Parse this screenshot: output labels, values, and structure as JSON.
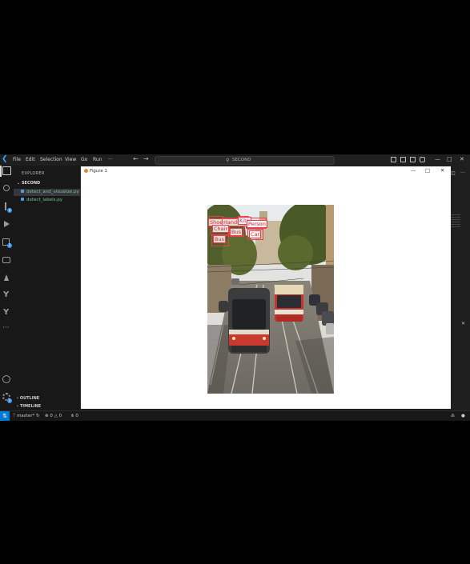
{
  "titlebar": {
    "menu": [
      "File",
      "Edit",
      "Selection",
      "View",
      "Go",
      "Run",
      "···"
    ],
    "command_center": "SECOND"
  },
  "activity_bar": {
    "badges": {
      "source_control": "4",
      "extensions": "2",
      "manage": "1"
    }
  },
  "sidebar": {
    "title": "EXPLORER",
    "folder": "SECOND",
    "files": [
      "detect_and_visualize.py",
      "detect_labels.py"
    ],
    "outline": "OUTLINE",
    "timeline": "TIMELINE"
  },
  "figure_window": {
    "title": "Figure 1",
    "labels": [
      {
        "text": "Shoe"
      },
      {
        "text": "Handbag"
      },
      {
        "text": "Kite"
      },
      {
        "text": "Person"
      },
      {
        "text": "Chair"
      },
      {
        "text": "Bus"
      },
      {
        "text": "Car"
      },
      {
        "text": "Bus"
      }
    ]
  },
  "statusbar": {
    "branch": "master*",
    "errors": "0",
    "warnings": "0",
    "ports": "0"
  },
  "colors": {
    "accent": "#0078d4",
    "detection_box": "#e8404f",
    "file_modified": "#73c991"
  }
}
